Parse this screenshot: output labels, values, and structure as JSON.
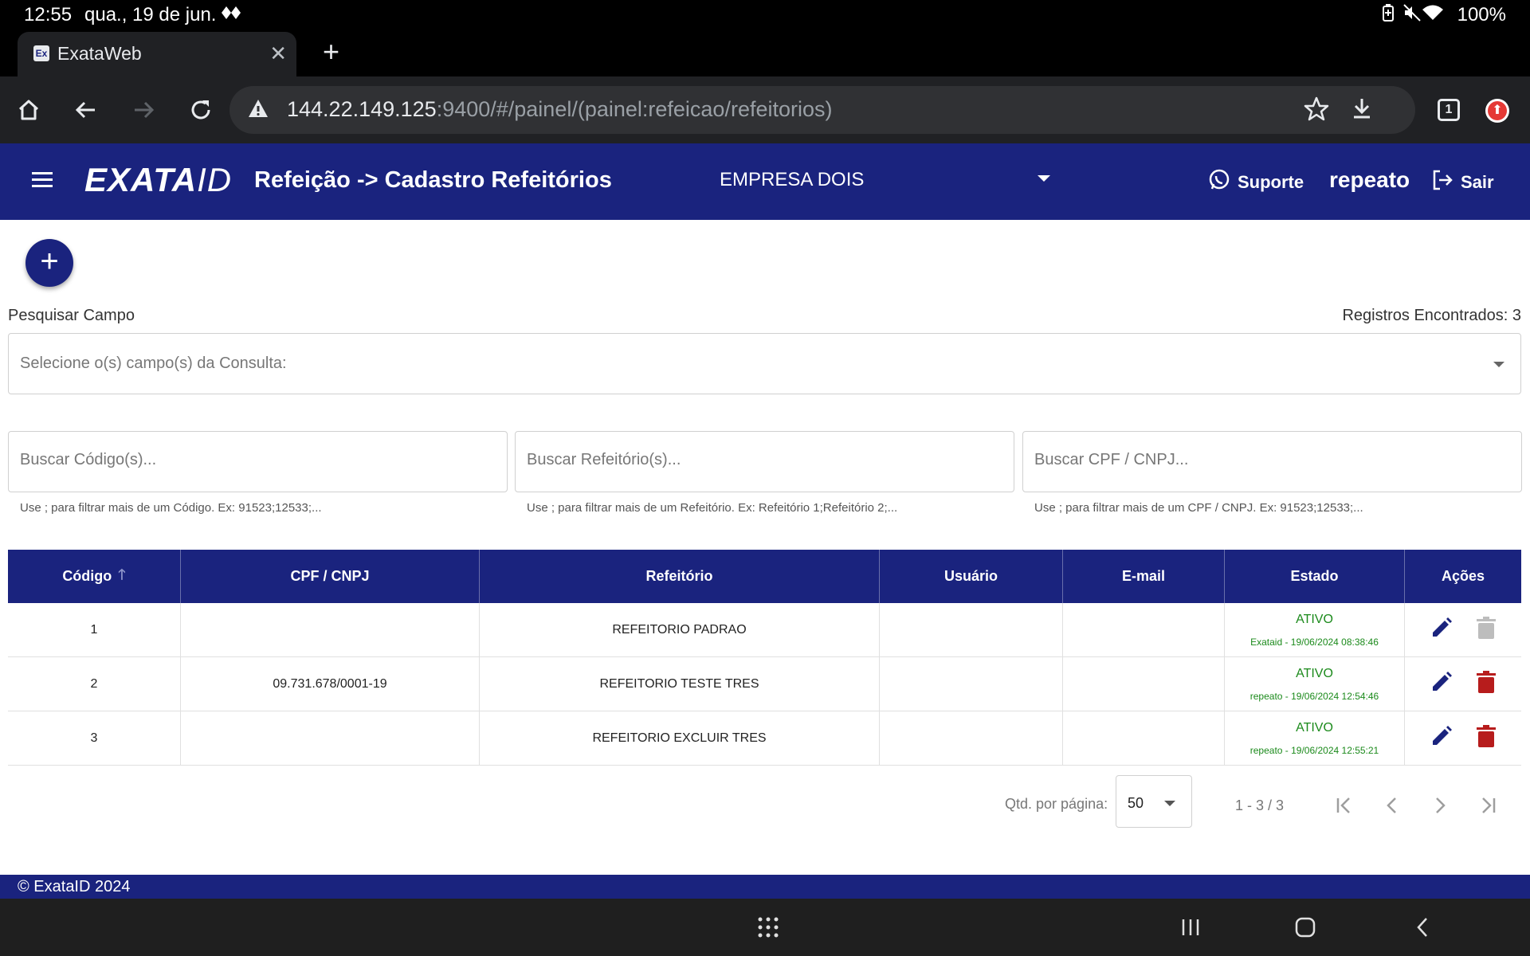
{
  "status_bar": {
    "time": "12:55",
    "date": "qua., 19 de jun.",
    "battery": "100%"
  },
  "browser": {
    "tab_title": "ExataWeb",
    "favicon": "Ex",
    "url_host": "144.22.149.125",
    "url_rest": ":9400/#/painel/(painel:refeicao/refeitorios)",
    "tab_count": "1"
  },
  "header": {
    "logo_text": "EXATA",
    "logo_id": "ID",
    "title": "Refeição -> Cadastro Refeitórios",
    "company": "EMPRESA DOIS",
    "support_label": "Suporte",
    "user": "repeato",
    "logout_label": "Sair"
  },
  "search": {
    "label": "Pesquisar Campo",
    "records": "Registros Encontrados: 3",
    "field_select_placeholder": "Selecione o(s) campo(s) da Consulta:",
    "code_placeholder": "Buscar Código(s)...",
    "code_hint": "Use ; para filtrar mais de um Código. Ex: 91523;12533;...",
    "refeitorio_placeholder": "Buscar Refeitório(s)...",
    "refeitorio_hint": "Use ; para filtrar mais de um Refeitório. Ex: Refeitório 1;Refeitório 2;...",
    "cpf_placeholder": "Buscar CPF / CNPJ...",
    "cpf_hint": "Use ; para filtrar mais de um CPF / CNPJ. Ex: 91523;12533;..."
  },
  "table": {
    "headers": [
      "Código",
      "CPF / CNPJ",
      "Refeitório",
      "Usuário",
      "E-mail",
      "Estado",
      "Ações"
    ],
    "rows": [
      {
        "codigo": "1",
        "cpf": "",
        "refeitorio": "REFEITORIO PADRAO",
        "usuario": "",
        "email": "",
        "estado": "ATIVO",
        "audit": "Exataid - 19/06/2024 08:38:46",
        "delete_enabled": false
      },
      {
        "codigo": "2",
        "cpf": "09.731.678/0001-19",
        "refeitorio": "REFEITORIO TESTE TRES",
        "usuario": "",
        "email": "",
        "estado": "ATIVO",
        "audit": "repeato - 19/06/2024 12:54:46",
        "delete_enabled": true
      },
      {
        "codigo": "3",
        "cpf": "",
        "refeitorio": "REFEITORIO EXCLUIR TRES",
        "usuario": "",
        "email": "",
        "estado": "ATIVO",
        "audit": "repeato - 19/06/2024 12:55:21",
        "delete_enabled": true
      }
    ]
  },
  "paginator": {
    "label": "Qtd. por página:",
    "page_size": "50",
    "range": "1 - 3 / 3"
  },
  "footer": {
    "text": "© ExataID 2024"
  },
  "colors": {
    "primary": "#1a237e",
    "active": "#1b8a1b",
    "delete": "#b71c1c",
    "disabled": "#bdbdbd"
  },
  "icons": {
    "status_bar": [
      "nearby-share-icon",
      "battery-saver-icon",
      "mute-icon",
      "wifi-icon",
      "battery-icon"
    ],
    "browser": [
      "home-icon",
      "back-icon",
      "forward-icon",
      "reload-icon",
      "warning-icon",
      "star-icon",
      "download-icon",
      "tab-switcher-icon",
      "profile-icon"
    ],
    "app": [
      "menu-icon",
      "whatsapp-icon",
      "logout-icon",
      "add-icon",
      "sort-asc-icon",
      "edit-icon",
      "delete-icon",
      "first-page-icon",
      "prev-page-icon",
      "next-page-icon",
      "last-page-icon"
    ]
  }
}
